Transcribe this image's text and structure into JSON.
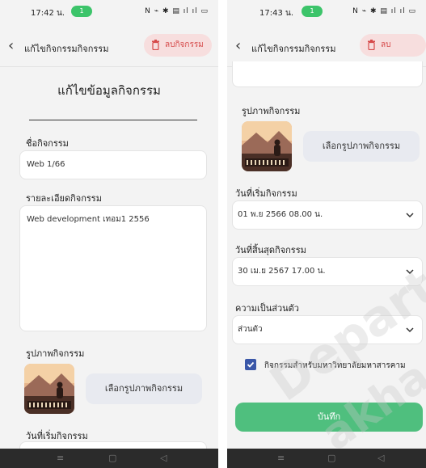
{
  "left": {
    "status": {
      "time": "17:42 น.",
      "pill": "1",
      "icons": "N ⌁ ✱ ▤ ıl ıl ▭"
    },
    "appbar": {
      "back_glyph": "‹",
      "title": "แก้ไขกิจกรรมกิจกรรม",
      "delete_label": "ลบกิจกรรม"
    },
    "form": {
      "heading": "แก้ไขข้อมูลกิจกรรม",
      "name_label": "ชื่อกิจกรรม",
      "name_value": "Web 1/66",
      "detail_label": "รายละเอียดกิจกรรม",
      "detail_value": "Web development เทอม1 2556",
      "image_label": "รูปภาพกิจกรรม",
      "pick_image_label": "เลือกรูปภาพกิจกรรม",
      "start_label": "วันที่เริ่มกิจกรรม"
    }
  },
  "right": {
    "status": {
      "time": "17:43 น.",
      "pill": "1",
      "icons": "N ⌁ ✱ ▤ ıl ıl ▭"
    },
    "appbar": {
      "back_glyph": "‹",
      "title": "แก้ไขกิจกรรมกิจกรรม",
      "delete_label": "ลบกิจกรรม"
    },
    "form": {
      "image_label": "รูปภาพกิจกรรม",
      "pick_image_label": "เลือกรูปภาพกิจกรรม",
      "start_label": "วันที่เริ่มกิจกรรม",
      "start_value": "01 พ.ย 2566 08.00 น.",
      "end_label": "วันที่สิ้นสุดกิจกรรม",
      "end_value": "30 เม.ย 2567 17.00 น.",
      "privacy_label": "ความเป็นส่วนตัว",
      "privacy_value": "ส่วนตัว",
      "checkbox_label": "กิจกรรมสำหรับมหาวิทยาลัยมหาสารคาม",
      "checkbox_checked": true,
      "save_label": "บันทึก"
    }
  },
  "navbar": {
    "menu_glyph": "≡",
    "home_glyph": "▢",
    "back_glyph": "◁"
  },
  "watermark": {
    "line1": "Depart",
    "line2": "akha"
  },
  "colors": {
    "save": "#4fbf7e",
    "delete_bg": "#f7dede",
    "delete_fg": "#d64a4a",
    "checkbox": "#3a57a8"
  }
}
